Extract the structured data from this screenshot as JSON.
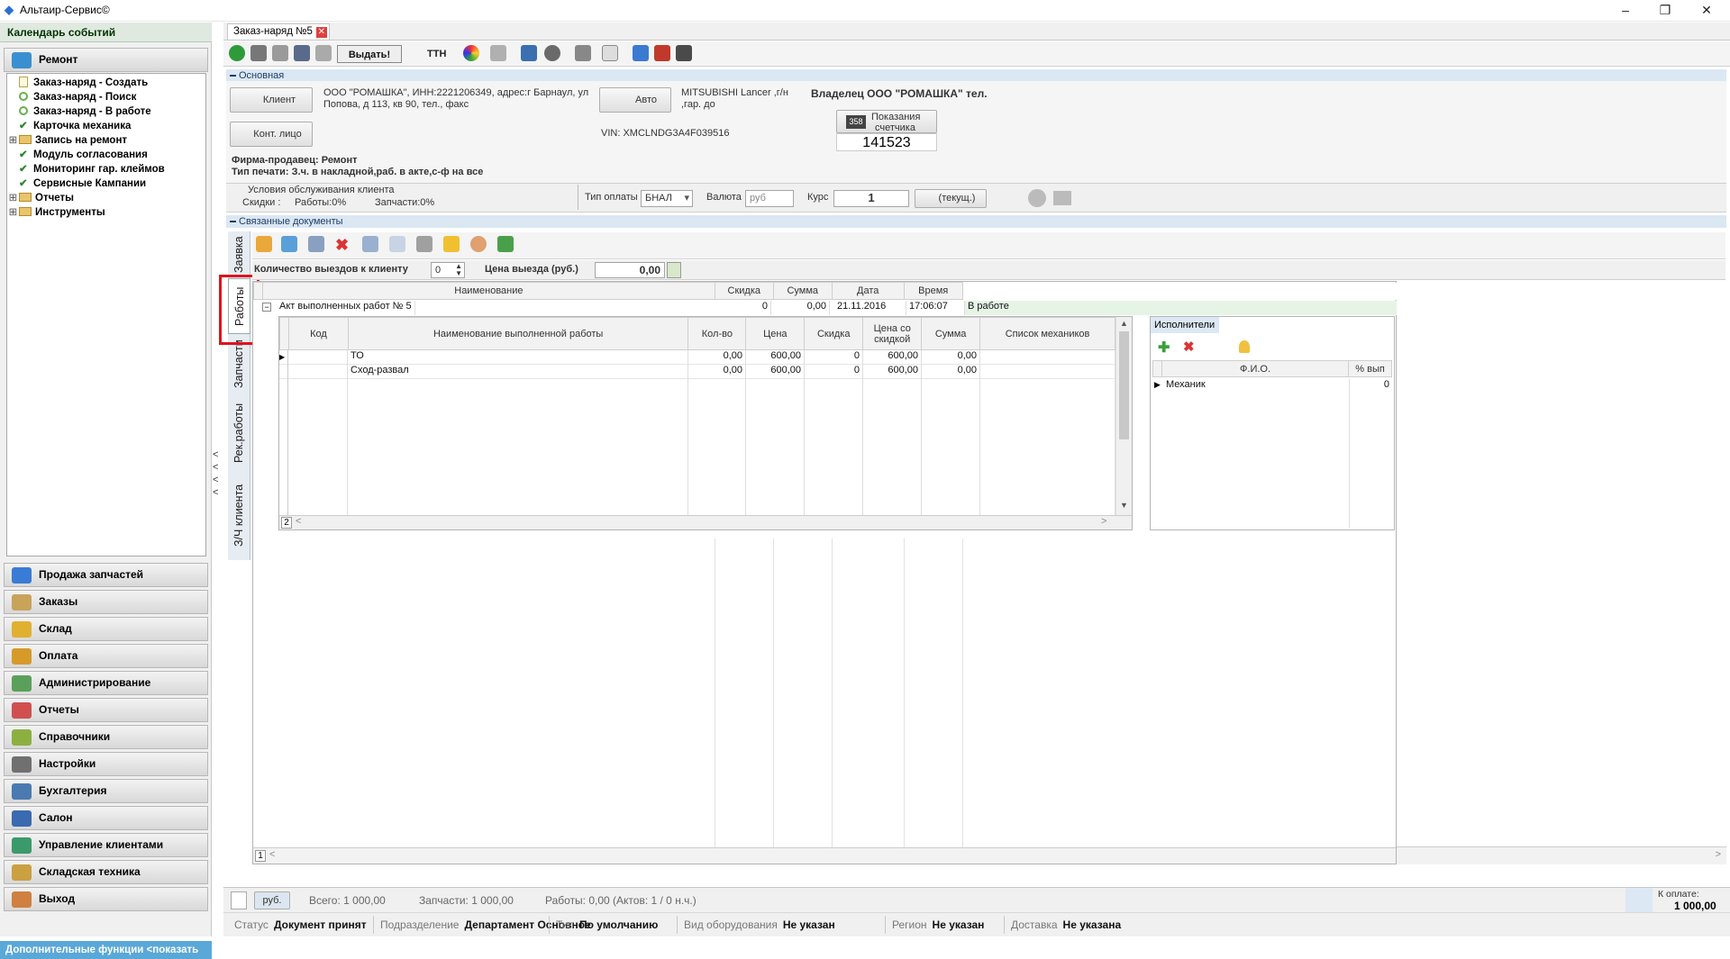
{
  "window": {
    "title": "Альтаир-Сервис©",
    "app_icon": "app-logo-icon"
  },
  "left_panel": {
    "calendar": "Календарь событий",
    "section": "Ремонт",
    "tree": [
      {
        "label": "Заказ-наряд - Создать",
        "icon": "document-icon"
      },
      {
        "label": "Заказ-наряд - Поиск",
        "icon": "ring-icon"
      },
      {
        "label": "Заказ-наряд - В работе",
        "icon": "ring-icon"
      },
      {
        "label": "Карточка механика",
        "icon": "check-icon"
      },
      {
        "label": "Запись на ремонт",
        "icon": "folder-icon"
      },
      {
        "label": "Модуль согласования",
        "icon": "check-icon"
      },
      {
        "label": "Мониторинг гар. клеймов",
        "icon": "check-icon"
      },
      {
        "label": "Сервисные Кампании",
        "icon": "check-icon"
      },
      {
        "label": "Отчеты",
        "icon": "folder-icon"
      },
      {
        "label": "Инструменты",
        "icon": "folder-icon"
      }
    ],
    "groups": [
      "Продажа запчастей",
      "Заказы",
      "Склад",
      "Оплата",
      "Администрирование",
      "Отчеты",
      "Справочники",
      "Настройки",
      "Бухгалтерия",
      "Салон",
      "Управление клиентами",
      "Складская техника",
      "Выход"
    ],
    "group_colors": [
      "#3a7bd5",
      "#caa35a",
      "#e0b030",
      "#d69a2a",
      "#5aa05a",
      "#d05050",
      "#8bb040",
      "#707070",
      "#4a7ab0",
      "#3a6ab0",
      "#3a9a6a",
      "#caa040",
      "#d08040"
    ],
    "more": "Дополнительные функции <показать"
  },
  "doc_tab": {
    "label": "Заказ-наряд №5"
  },
  "toolbar": {
    "issue": "Выдать!",
    "ttn": "ТТН"
  },
  "basic": {
    "section": "Основная",
    "client_btn": "Клиент",
    "client_info": "ООО \"РОМАШКА\", ИНН:2221206349, адрес:г Барнаул, ул Попова, д 113, кв 90, тел., факс",
    "client_line1": "ООО \"РОМАШКА\", ИНН:2221206349, адрес:г Барнаул, ул",
    "client_line2": "Попова, д 113, кв 90, тел., факс",
    "contact_btn": "Конт. лицо",
    "auto_btn": "Авто",
    "auto_line1": "MITSUBISHI Lancer ,г/н",
    "auto_line2": ",гар. до",
    "vin": "VIN: XMCLNDG3A4F039516",
    "owner": "Владелец  ООО \"РОМАШКА\" тел.",
    "counter_label1": "Показания",
    "counter_label2": "счетчика",
    "counter_value": "141523",
    "seller": "Фирма-продавец: Ремонт",
    "print_type": "Тип печати: З.ч. в накладной,раб. в акте,с-ф на все",
    "conditions": "Условия обслуживания клиента",
    "discounts": "Скидки :",
    "works_disc": "Работы:0%",
    "parts_disc": "Запчасти:0%",
    "pay_type_label": "Тип оплаты",
    "pay_type": "БНАЛ",
    "currency_label": "Валюта",
    "currency": "руб",
    "rate_label": "Курс",
    "rate": "1",
    "current_btn": "(текущ.)"
  },
  "linked": {
    "section": "Связанные документы"
  },
  "vtabs": [
    "Заявка",
    "Работы",
    "Запчасти",
    "Рек.работы",
    "З/Ч клиента"
  ],
  "counts": {
    "trips_label": "Количество выездов к клиенту",
    "trips": "0",
    "price_label": "Цена выезда (руб.)",
    "price": "0,00"
  },
  "grid": {
    "headers": [
      "Наименование",
      "Скидка",
      "Сумма",
      "Дата",
      "Время"
    ],
    "act": {
      "name": "Акт выполненных работ № 5",
      "discount": "0",
      "sum": "0,00",
      "date": "21.11.2016",
      "time": "17:06:07",
      "status": "В работе"
    },
    "sub_headers": [
      "Код",
      "Наименование выполненной работы",
      "Кол-во",
      "Цена",
      "Скидка",
      "Цена со скидкой",
      "Сумма",
      "Список механиков"
    ],
    "rows": [
      {
        "code": "",
        "name": "ТО",
        "qty": "0,00",
        "price": "600,00",
        "disc": "0",
        "dprice": "600,00",
        "sum": "0,00",
        "mech": ""
      },
      {
        "code": "",
        "name": "Сход-развал",
        "qty": "0,00",
        "price": "600,00",
        "disc": "0",
        "dprice": "600,00",
        "sum": "0,00",
        "mech": ""
      }
    ],
    "sub_count": "2",
    "main_count": "1",
    "executors": {
      "tab": "Исполнители",
      "col_fio": "Ф.И.О.",
      "col_pct": "% вып",
      "rows": [
        {
          "name": "Механик",
          "pct": "0"
        }
      ]
    }
  },
  "status": {
    "currency_btn": "руб.",
    "total": "Всего: 1 000,00",
    "parts": "Запчасти: 1 000,00",
    "works": "Работы: 0,00 (Актов: 1 / 0 н.ч.)",
    "to_pay_label": "К оплате:",
    "to_pay": "1 000,00"
  },
  "info": [
    {
      "label": "Статус",
      "value": "Документ принят"
    },
    {
      "label": "Подразделение",
      "value": "Департамент Основное"
    },
    {
      "label": "Тип",
      "value": "По умолчанию"
    },
    {
      "label": "Вид оборудования",
      "value": "Не указан"
    },
    {
      "label": "Регион",
      "value": "Не указан"
    },
    {
      "label": "Доставка",
      "value": "Не указана"
    }
  ]
}
